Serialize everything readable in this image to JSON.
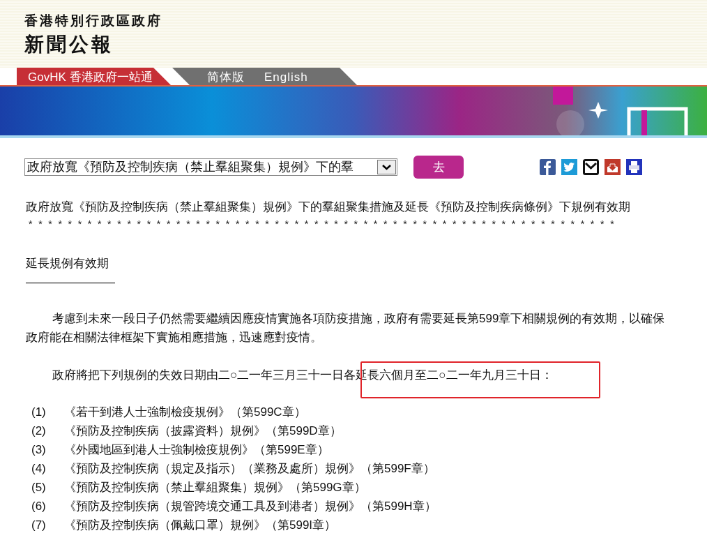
{
  "header": {
    "org": "香港特別行政區政府",
    "title": "新聞公報"
  },
  "nav": {
    "home_link": "GovHK 香港政府一站通",
    "languages": [
      "简体版",
      "English"
    ]
  },
  "toolbar": {
    "select_value": "政府放寬《預防及控制疾病（禁止羣組聚集）規例》下的羣",
    "go_button": "去"
  },
  "article": {
    "title": "政府放寬《預防及控制疾病（禁止羣組聚集）規例》下的羣組聚集措施及延長《預防及控制疾病條例》下規例有效期",
    "separator": "* * * * * * * * * * * * * * * * * * * * * * * * * * * * * * * * * * * * * * * * * * * * * * * * * * * * * * * * * * * *",
    "section_heading": "延長規例有效期",
    "section_rule": "————————",
    "paragraphs": [
      "考慮到未來一段日子仍然需要繼續因應疫情實施各項防疫措施，政府有需要延長第599章下相關規例的有效期，以確保政府能在相關法律框架下實施相應措施，迅速應對疫情。",
      "政府將把下列規例的失效日期由二○二一年三月三十一日各延長六個月至二○二一年九月三十日："
    ],
    "regulations": [
      {
        "number": "(1)",
        "name": "《若干到港人士強制檢疫規例》（第599C章）"
      },
      {
        "number": "(2)",
        "name": "《預防及控制疾病（披露資料）規例》（第599D章）"
      },
      {
        "number": "(3)",
        "name": "《外國地區到港人士強制檢疫規例》（第599E章）"
      },
      {
        "number": "(4)",
        "name": "《預防及控制疾病（規定及指示）（業務及處所）規例》（第599F章）"
      },
      {
        "number": "(5)",
        "name": "《預防及控制疾病（禁止羣組聚集）規例》（第599G章）"
      },
      {
        "number": "(6)",
        "name": "《預防及控制疾病（規管跨境交通工具及到港者）規例》（第599H章）"
      },
      {
        "number": "(7)",
        "name": "《預防及控制疾病（佩戴口罩）規例》（第599I章）"
      }
    ]
  }
}
